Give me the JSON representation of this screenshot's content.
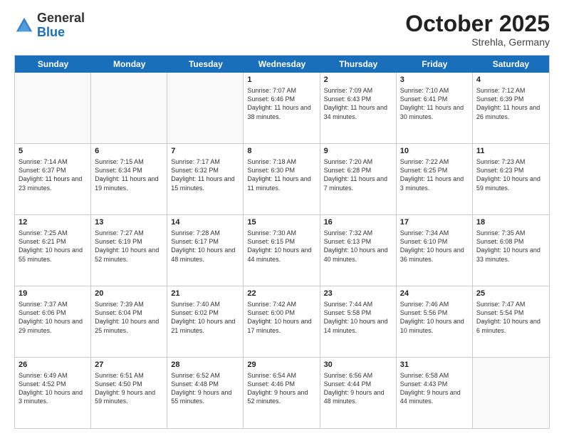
{
  "header": {
    "logo": {
      "general": "General",
      "blue": "Blue"
    },
    "month": "October 2025",
    "location": "Strehla, Germany"
  },
  "weekdays": [
    "Sunday",
    "Monday",
    "Tuesday",
    "Wednesday",
    "Thursday",
    "Friday",
    "Saturday"
  ],
  "rows": [
    [
      {
        "day": "",
        "sunrise": "",
        "sunset": "",
        "daylight": ""
      },
      {
        "day": "",
        "sunrise": "",
        "sunset": "",
        "daylight": ""
      },
      {
        "day": "",
        "sunrise": "",
        "sunset": "",
        "daylight": ""
      },
      {
        "day": "1",
        "sunrise": "Sunrise: 7:07 AM",
        "sunset": "Sunset: 6:46 PM",
        "daylight": "Daylight: 11 hours and 38 minutes."
      },
      {
        "day": "2",
        "sunrise": "Sunrise: 7:09 AM",
        "sunset": "Sunset: 6:43 PM",
        "daylight": "Daylight: 11 hours and 34 minutes."
      },
      {
        "day": "3",
        "sunrise": "Sunrise: 7:10 AM",
        "sunset": "Sunset: 6:41 PM",
        "daylight": "Daylight: 11 hours and 30 minutes."
      },
      {
        "day": "4",
        "sunrise": "Sunrise: 7:12 AM",
        "sunset": "Sunset: 6:39 PM",
        "daylight": "Daylight: 11 hours and 26 minutes."
      }
    ],
    [
      {
        "day": "5",
        "sunrise": "Sunrise: 7:14 AM",
        "sunset": "Sunset: 6:37 PM",
        "daylight": "Daylight: 11 hours and 23 minutes."
      },
      {
        "day": "6",
        "sunrise": "Sunrise: 7:15 AM",
        "sunset": "Sunset: 6:34 PM",
        "daylight": "Daylight: 11 hours and 19 minutes."
      },
      {
        "day": "7",
        "sunrise": "Sunrise: 7:17 AM",
        "sunset": "Sunset: 6:32 PM",
        "daylight": "Daylight: 11 hours and 15 minutes."
      },
      {
        "day": "8",
        "sunrise": "Sunrise: 7:18 AM",
        "sunset": "Sunset: 6:30 PM",
        "daylight": "Daylight: 11 hours and 11 minutes."
      },
      {
        "day": "9",
        "sunrise": "Sunrise: 7:20 AM",
        "sunset": "Sunset: 6:28 PM",
        "daylight": "Daylight: 11 hours and 7 minutes."
      },
      {
        "day": "10",
        "sunrise": "Sunrise: 7:22 AM",
        "sunset": "Sunset: 6:25 PM",
        "daylight": "Daylight: 11 hours and 3 minutes."
      },
      {
        "day": "11",
        "sunrise": "Sunrise: 7:23 AM",
        "sunset": "Sunset: 6:23 PM",
        "daylight": "Daylight: 10 hours and 59 minutes."
      }
    ],
    [
      {
        "day": "12",
        "sunrise": "Sunrise: 7:25 AM",
        "sunset": "Sunset: 6:21 PM",
        "daylight": "Daylight: 10 hours and 55 minutes."
      },
      {
        "day": "13",
        "sunrise": "Sunrise: 7:27 AM",
        "sunset": "Sunset: 6:19 PM",
        "daylight": "Daylight: 10 hours and 52 minutes."
      },
      {
        "day": "14",
        "sunrise": "Sunrise: 7:28 AM",
        "sunset": "Sunset: 6:17 PM",
        "daylight": "Daylight: 10 hours and 48 minutes."
      },
      {
        "day": "15",
        "sunrise": "Sunrise: 7:30 AM",
        "sunset": "Sunset: 6:15 PM",
        "daylight": "Daylight: 10 hours and 44 minutes."
      },
      {
        "day": "16",
        "sunrise": "Sunrise: 7:32 AM",
        "sunset": "Sunset: 6:13 PM",
        "daylight": "Daylight: 10 hours and 40 minutes."
      },
      {
        "day": "17",
        "sunrise": "Sunrise: 7:34 AM",
        "sunset": "Sunset: 6:10 PM",
        "daylight": "Daylight: 10 hours and 36 minutes."
      },
      {
        "day": "18",
        "sunrise": "Sunrise: 7:35 AM",
        "sunset": "Sunset: 6:08 PM",
        "daylight": "Daylight: 10 hours and 33 minutes."
      }
    ],
    [
      {
        "day": "19",
        "sunrise": "Sunrise: 7:37 AM",
        "sunset": "Sunset: 6:06 PM",
        "daylight": "Daylight: 10 hours and 29 minutes."
      },
      {
        "day": "20",
        "sunrise": "Sunrise: 7:39 AM",
        "sunset": "Sunset: 6:04 PM",
        "daylight": "Daylight: 10 hours and 25 minutes."
      },
      {
        "day": "21",
        "sunrise": "Sunrise: 7:40 AM",
        "sunset": "Sunset: 6:02 PM",
        "daylight": "Daylight: 10 hours and 21 minutes."
      },
      {
        "day": "22",
        "sunrise": "Sunrise: 7:42 AM",
        "sunset": "Sunset: 6:00 PM",
        "daylight": "Daylight: 10 hours and 17 minutes."
      },
      {
        "day": "23",
        "sunrise": "Sunrise: 7:44 AM",
        "sunset": "Sunset: 5:58 PM",
        "daylight": "Daylight: 10 hours and 14 minutes."
      },
      {
        "day": "24",
        "sunrise": "Sunrise: 7:46 AM",
        "sunset": "Sunset: 5:56 PM",
        "daylight": "Daylight: 10 hours and 10 minutes."
      },
      {
        "day": "25",
        "sunrise": "Sunrise: 7:47 AM",
        "sunset": "Sunset: 5:54 PM",
        "daylight": "Daylight: 10 hours and 6 minutes."
      }
    ],
    [
      {
        "day": "26",
        "sunrise": "Sunrise: 6:49 AM",
        "sunset": "Sunset: 4:52 PM",
        "daylight": "Daylight: 10 hours and 3 minutes."
      },
      {
        "day": "27",
        "sunrise": "Sunrise: 6:51 AM",
        "sunset": "Sunset: 4:50 PM",
        "daylight": "Daylight: 9 hours and 59 minutes."
      },
      {
        "day": "28",
        "sunrise": "Sunrise: 6:52 AM",
        "sunset": "Sunset: 4:48 PM",
        "daylight": "Daylight: 9 hours and 55 minutes."
      },
      {
        "day": "29",
        "sunrise": "Sunrise: 6:54 AM",
        "sunset": "Sunset: 4:46 PM",
        "daylight": "Daylight: 9 hours and 52 minutes."
      },
      {
        "day": "30",
        "sunrise": "Sunrise: 6:56 AM",
        "sunset": "Sunset: 4:44 PM",
        "daylight": "Daylight: 9 hours and 48 minutes."
      },
      {
        "day": "31",
        "sunrise": "Sunrise: 6:58 AM",
        "sunset": "Sunset: 4:43 PM",
        "daylight": "Daylight: 9 hours and 44 minutes."
      },
      {
        "day": "",
        "sunrise": "",
        "sunset": "",
        "daylight": ""
      }
    ]
  ]
}
